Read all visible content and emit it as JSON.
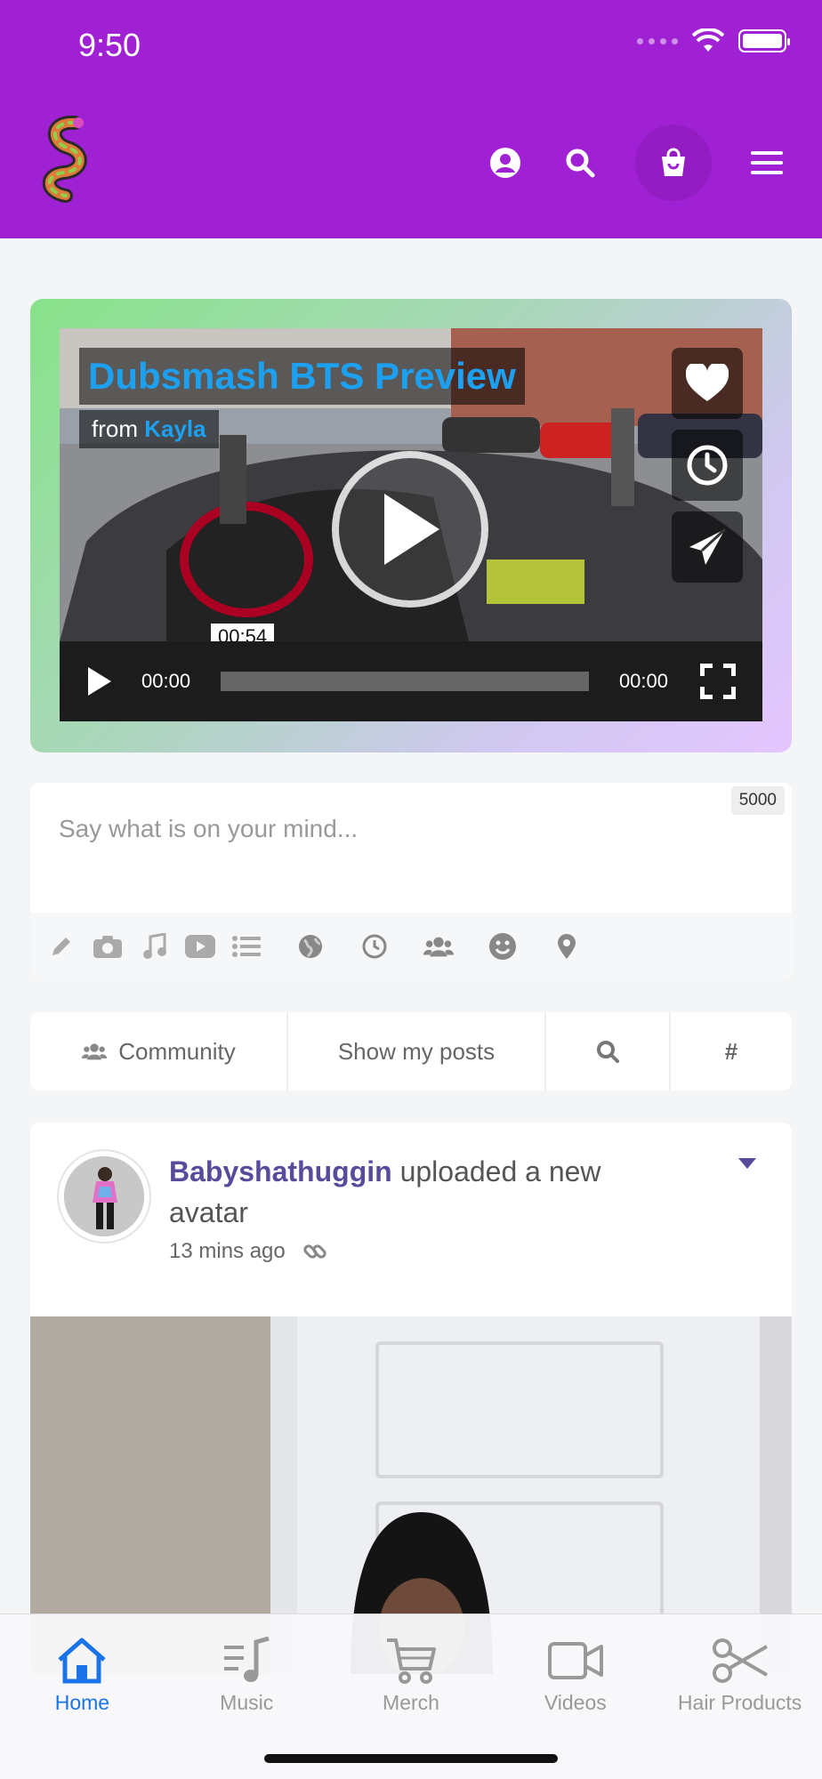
{
  "status_bar": {
    "time": "9:50"
  },
  "video": {
    "title": "Dubsmash BTS Preview",
    "from_label": "from",
    "from_user": "Kayla",
    "duration_badge": "00:54",
    "current_time": "00:00",
    "total_time": "00:00"
  },
  "composer": {
    "placeholder": "Say what is on your mind...",
    "char_limit": "5000"
  },
  "filters": {
    "community": "Community",
    "show_my_posts": "Show my posts",
    "hashtag": "#"
  },
  "post": {
    "username": "Babyshathuggin",
    "action_text": "uploaded a new avatar",
    "time_ago": "13 mins ago"
  },
  "tabbar": {
    "items": [
      {
        "label": "Home",
        "icon": "home-icon",
        "active": true
      },
      {
        "label": "Music",
        "icon": "music-icon",
        "active": false
      },
      {
        "label": "Merch",
        "icon": "cart-icon",
        "active": false
      },
      {
        "label": "Videos",
        "icon": "video-camera-icon",
        "active": false
      },
      {
        "label": "Hair Products",
        "icon": "scissors-icon",
        "active": false
      }
    ]
  },
  "colors": {
    "header_bg": "#a020d4",
    "accent_blue": "#1a73e8",
    "username_purple": "#5a4a9c",
    "video_title_blue": "#1ea0f0"
  }
}
